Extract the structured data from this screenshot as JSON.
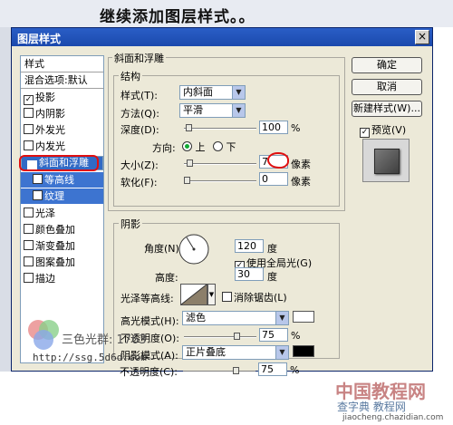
{
  "banner": {
    "title": "继续添加图层样式。。"
  },
  "dialog": {
    "title": "图层样式",
    "close": "×"
  },
  "style_list": {
    "header": "样式",
    "blend": "混合选项:默认",
    "items": [
      {
        "label": "投影",
        "checked": "✓"
      },
      {
        "label": "内阴影",
        "checked": ""
      },
      {
        "label": "外发光",
        "checked": ""
      },
      {
        "label": "内发光",
        "checked": ""
      },
      {
        "label": "斜面和浮雕",
        "checked": "✓"
      },
      {
        "label": "等高线",
        "checked": ""
      },
      {
        "label": "纹理",
        "checked": ""
      },
      {
        "label": "光泽",
        "checked": ""
      },
      {
        "label": "颜色叠加",
        "checked": ""
      },
      {
        "label": "渐变叠加",
        "checked": ""
      },
      {
        "label": "图案叠加",
        "checked": ""
      },
      {
        "label": "描边",
        "checked": ""
      }
    ]
  },
  "bevel": {
    "section": "斜面和浮雕",
    "structure": "结构",
    "style_label": "样式(T):",
    "style_value": "内斜面",
    "method_label": "方法(Q):",
    "method_value": "平滑",
    "depth_label": "深度(D):",
    "depth_value": "100",
    "depth_unit": "%",
    "direction_label": "方向:",
    "dir_up": "上",
    "dir_down": "下",
    "size_label": "大小(Z):",
    "size_value": "7",
    "size_unit": "像素",
    "soften_label": "软化(F):",
    "soften_value": "0",
    "soften_unit": "像素"
  },
  "shading": {
    "section": "阴影",
    "angle_label": "角度(N):",
    "angle_value": "120",
    "angle_unit": "度",
    "global_light": "使用全局光(G)",
    "altitude_label": "高度:",
    "altitude_value": "30",
    "altitude_unit": "度",
    "gloss_label": "光泽等高线:",
    "antialias": "消除锯齿(L)",
    "highlight_label": "高光模式(H):",
    "highlight_value": "滤色",
    "highlight_color": "#ffffff",
    "hl_opacity_label": "不透明度(O):",
    "hl_opacity_value": "75",
    "hl_opacity_unit": "%",
    "shadow_label": "阴影模式(A):",
    "shadow_value": "正片叠底",
    "shadow_color": "#000000",
    "sh_opacity_label": "不透明度(C):",
    "sh_opacity_value": "75",
    "sh_opacity_unit": "%"
  },
  "buttons": {
    "ok": "确定",
    "cancel": "取消",
    "new_style": "新建样式(W)...",
    "preview": "预览(V)"
  },
  "watermark": {
    "left_text": "三色光群: 1763",
    "left_url": "http://ssg.5d6d.com",
    "brand_big": "中国教程网",
    "brand_sub": "查字典 教程网",
    "brand_url": "jiaocheng.chazidian.com"
  }
}
